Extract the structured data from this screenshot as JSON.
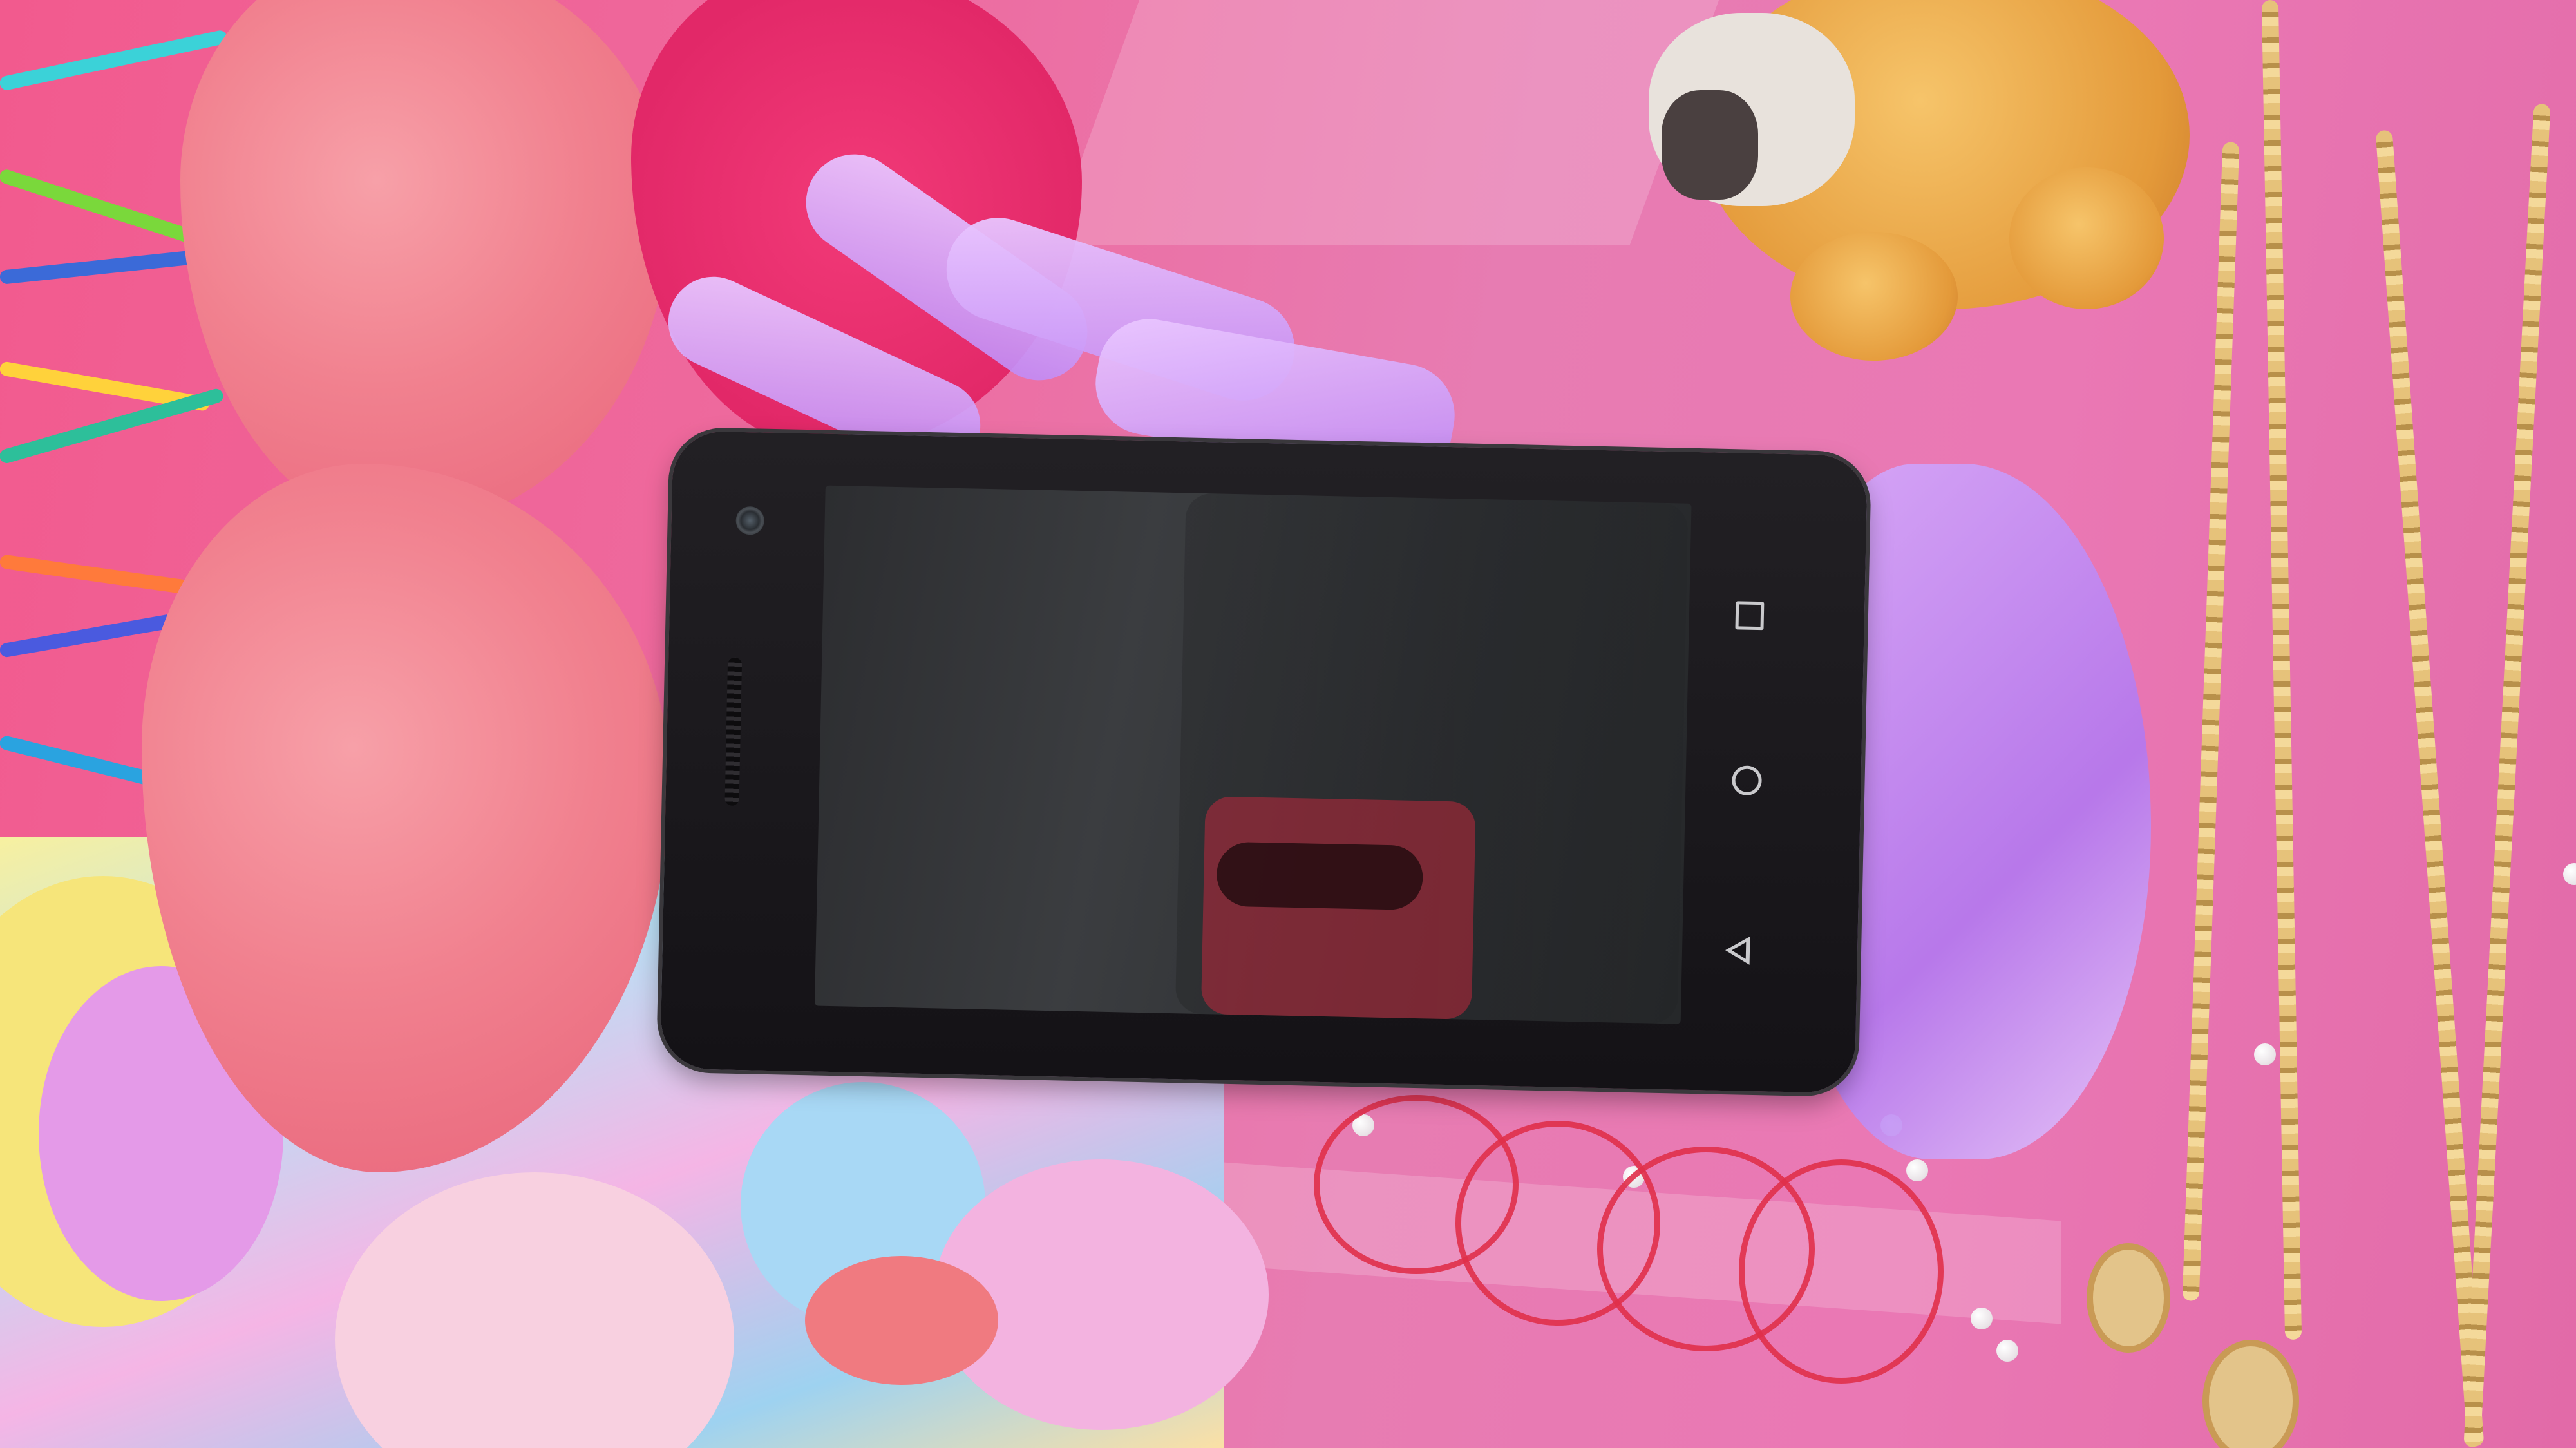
{
  "scene": {
    "subject": "smartphone",
    "screen_state": "off",
    "colors": {
      "background_pink": "#e85a9a",
      "tissue_pink": "#f1818f",
      "stand_purple": "#b878f0",
      "phone_body": "#1a181c",
      "gold_chain": "#e6c27a",
      "bear_fur": "#e49a3a"
    }
  },
  "phone": {
    "nav_buttons": [
      "square-icon",
      "circle-icon",
      "triangle-icon"
    ],
    "front_features": [
      "camera-icon",
      "earpiece-speaker"
    ]
  }
}
